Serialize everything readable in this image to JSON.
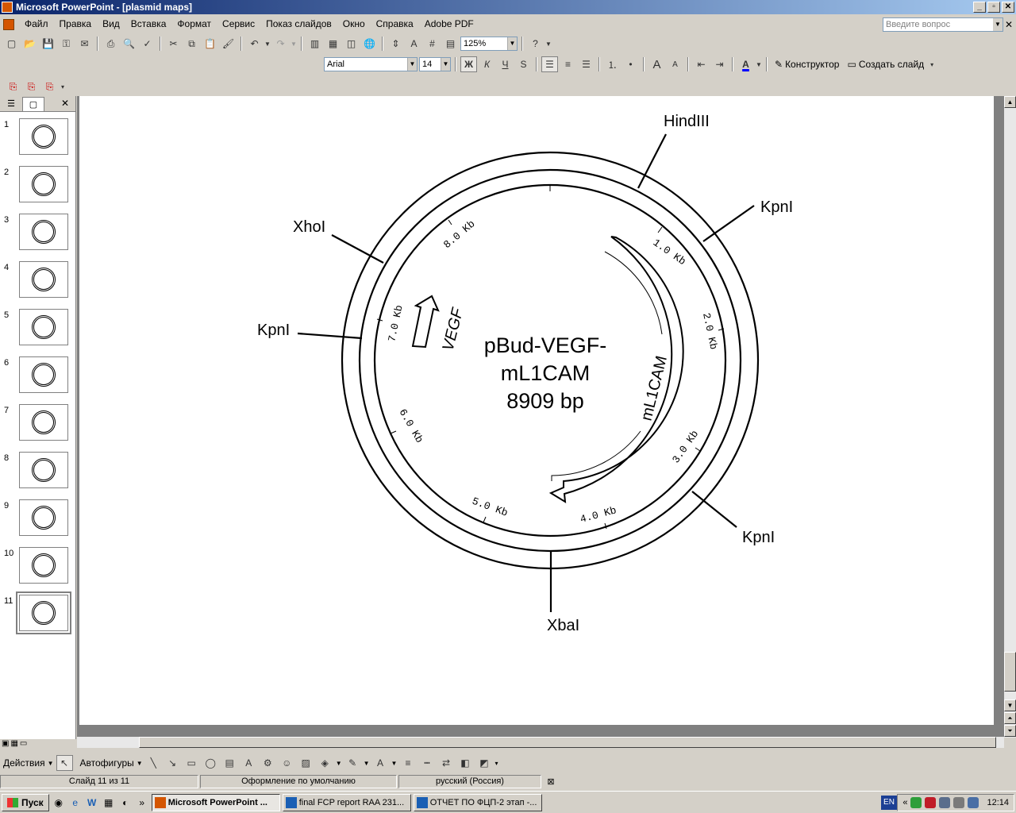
{
  "window": {
    "title": "Microsoft PowerPoint - [plasmid maps]",
    "min": "_",
    "max": "▫",
    "close": "✕"
  },
  "menu": [
    "Файл",
    "Правка",
    "Вид",
    "Вставка",
    "Формат",
    "Сервис",
    "Показ слайдов",
    "Окно",
    "Справка",
    "Adobe PDF"
  ],
  "help_placeholder": "Введите вопрос",
  "doc_close": "✕",
  "toolbar": {
    "zoom": "125%",
    "font": "Arial",
    "size": "14",
    "bold": "Ж",
    "italic": "К",
    "underline": "Ч",
    "shadow": "S",
    "designer": "Конструктор",
    "new_slide": "Создать слайд",
    "font_color_glyph": "A",
    "grow": "A",
    "shrink": "A"
  },
  "slide_pane": {
    "close": "✕",
    "slides": [
      "1",
      "2",
      "3",
      "4",
      "5",
      "6",
      "7",
      "8",
      "9",
      "10",
      "11"
    ],
    "current": 11
  },
  "plasmid": {
    "name_line1": "pBud-VEGF-",
    "name_line2": "mL1CAM",
    "size": "8909 bp",
    "sites": [
      "HindIII",
      "KpnI",
      "KpnI",
      "XbaI",
      "KpnI",
      "XhoI"
    ],
    "genes": [
      "mL1CAM",
      "VEGF"
    ],
    "ticks": [
      "1.0 Kb",
      "2.0 Kb",
      "3.0 Kb",
      "4.0 Kb",
      "5.0 Kb",
      "6.0 Kb",
      "7.0 Kb",
      "8.0 Kb"
    ]
  },
  "draw_toolbar": {
    "actions": "Действия",
    "autoshapes": "Автофигуры"
  },
  "status": {
    "slide": "Слайд 11 из 11",
    "design": "Оформление по умолчанию",
    "language": "русский (Россия)"
  },
  "taskbar": {
    "start": "Пуск",
    "tasks": [
      "Microsoft PowerPoint ...",
      "final FCP report RAA 231...",
      "ОТЧЕТ ПО ФЦП-2 этап -..."
    ],
    "lang": "EN",
    "time": "12:14",
    "more": "»",
    "tray_more": "«"
  },
  "colors": {
    "titlebar_start": "#0a246a",
    "titlebar_end": "#a6caf0",
    "face": "#d4d0c8",
    "workspace": "#808080"
  }
}
